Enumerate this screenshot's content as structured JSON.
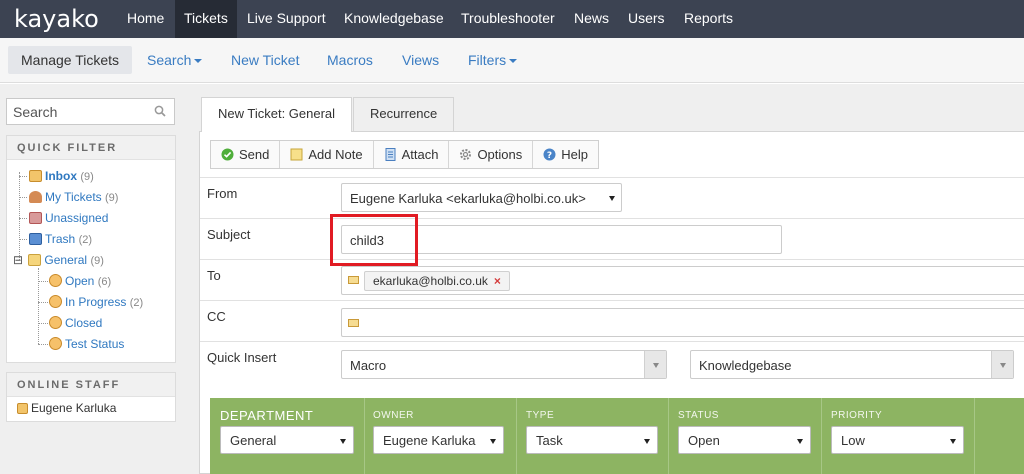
{
  "brand": {
    "logo_text": "kayako"
  },
  "topnav": {
    "items": [
      {
        "label": "Home"
      },
      {
        "label": "Tickets"
      },
      {
        "label": "Live Support"
      },
      {
        "label": "Knowledgebase"
      },
      {
        "label": "Troubleshooter"
      },
      {
        "label": "News"
      },
      {
        "label": "Users"
      },
      {
        "label": "Reports"
      }
    ],
    "active": "Tickets"
  },
  "subnav": {
    "items": [
      {
        "label": "Manage Tickets"
      },
      {
        "label": "Search"
      },
      {
        "label": "New Ticket"
      },
      {
        "label": "Macros"
      },
      {
        "label": "Views"
      },
      {
        "label": "Filters"
      }
    ],
    "active": "Manage Tickets"
  },
  "sidebar": {
    "search": {
      "placeholder": "Search"
    },
    "quick_filter": {
      "heading": "QUICK FILTER",
      "items": [
        {
          "label": "Inbox",
          "count": "(9)"
        },
        {
          "label": "My Tickets",
          "count": "(9)"
        },
        {
          "label": "Unassigned",
          "count": ""
        },
        {
          "label": "Trash",
          "count": "(2)"
        },
        {
          "label": "General",
          "count": "(9)"
        },
        {
          "label": "Open",
          "count": "(6)"
        },
        {
          "label": "In Progress",
          "count": "(2)"
        },
        {
          "label": "Closed",
          "count": ""
        },
        {
          "label": "Test Status",
          "count": ""
        }
      ],
      "expander_symbol": "⊟"
    },
    "online_staff": {
      "heading": "ONLINE STAFF",
      "members": [
        {
          "name": "Eugene Karluka"
        }
      ]
    }
  },
  "tabs": [
    {
      "label": "New Ticket: General"
    },
    {
      "label": "Recurrence"
    }
  ],
  "toolbar": {
    "buttons": [
      {
        "label": "Send",
        "icon": "check-circle-icon"
      },
      {
        "label": "Add Note",
        "icon": "note-icon"
      },
      {
        "label": "Attach",
        "icon": "document-icon"
      },
      {
        "label": "Options",
        "icon": "gear-icon"
      },
      {
        "label": "Help",
        "icon": "help-icon"
      }
    ]
  },
  "form": {
    "from": {
      "label": "From",
      "value": "Eugene Karluka <ekarluka@holbi.co.uk>"
    },
    "subject": {
      "label": "Subject",
      "value": "child3"
    },
    "to": {
      "label": "To",
      "recipients": [
        {
          "email": "ekarluka@holbi.co.uk",
          "remove": "×"
        }
      ]
    },
    "cc": {
      "label": "CC",
      "value": ""
    },
    "quick_insert": {
      "label": "Quick Insert",
      "macro": "Macro",
      "knowledgebase": "Knowledgebase"
    }
  },
  "properties": {
    "department": {
      "label": "DEPARTMENT",
      "value": "General"
    },
    "owner": {
      "label": "OWNER",
      "value": "Eugene Karluka"
    },
    "type": {
      "label": "TYPE",
      "value": "Task"
    },
    "status": {
      "label": "STATUS",
      "value": "Open"
    },
    "priority": {
      "label": "PRIORITY",
      "value": "Low"
    }
  },
  "colors": {
    "topnav_bg": "#3c4352",
    "link": "#2f78c0",
    "properties_bg": "#8db462",
    "highlight_border": "#e11b23"
  }
}
